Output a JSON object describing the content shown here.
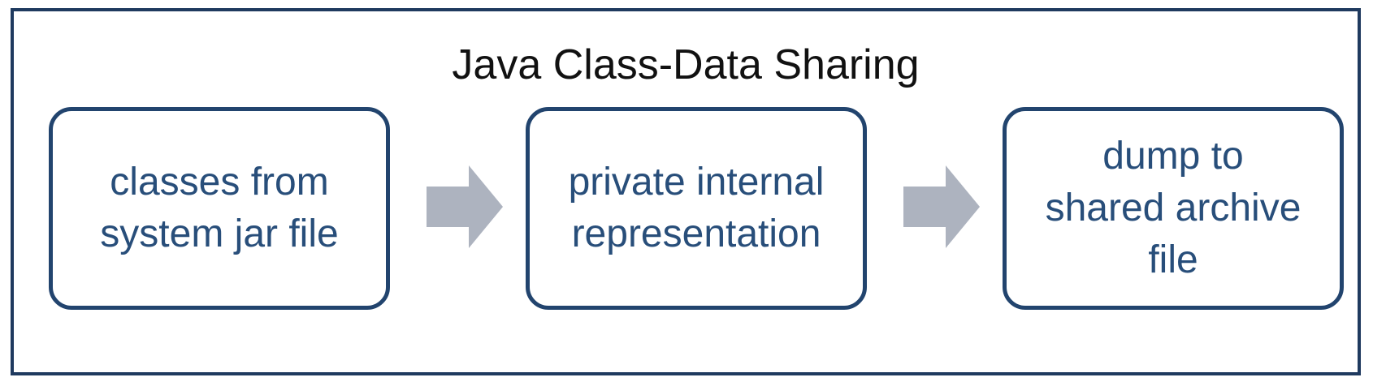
{
  "diagram": {
    "title": "Java Class-Data Sharing",
    "steps": [
      {
        "label": "classes from\nsystem jar file"
      },
      {
        "label": "private internal\nrepresentation"
      },
      {
        "label": "dump to\nshared archive\nfile"
      }
    ],
    "colors": {
      "frame_border": "#1f3a5f",
      "box_border": "#22446e",
      "box_text": "#284e7a",
      "arrow_fill": "#adb3bf",
      "title_text": "#111111"
    }
  }
}
